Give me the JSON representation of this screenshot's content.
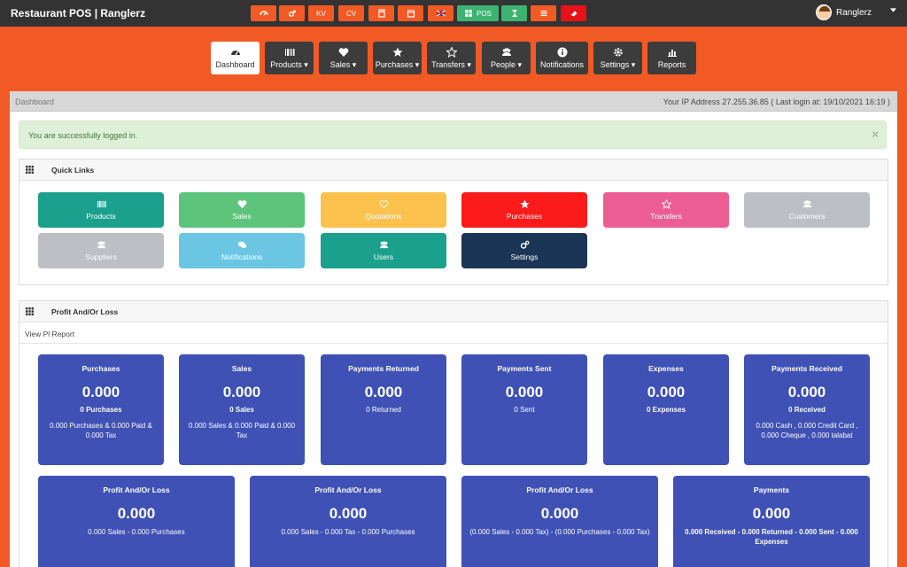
{
  "app": {
    "title": "Restaurant POS | Ranglerz"
  },
  "topbar": {
    "quick_buttons": [
      {
        "label": "",
        "icon": "dashboard-icon",
        "color": "#f15a24"
      },
      {
        "label": "",
        "icon": "cogs-icon",
        "color": "#f15a24"
      },
      {
        "label": "KV",
        "icon": "",
        "color": "#f15a24"
      },
      {
        "label": "CV",
        "icon": "",
        "color": "#f15a24"
      },
      {
        "label": "",
        "icon": "calculator-icon",
        "color": "#f15a24"
      },
      {
        "label": "",
        "icon": "calendar-icon",
        "color": "#f15a24"
      },
      {
        "label": "",
        "icon": "uk-flag-icon",
        "color": "#f15a24"
      },
      {
        "label": "POS",
        "icon": "grid-icon",
        "color": "#3cb371"
      },
      {
        "label": "",
        "icon": "hourglass-icon",
        "color": "#3cb371"
      },
      {
        "label": "",
        "icon": "list-icon",
        "color": "#f15a24"
      },
      {
        "label": "",
        "icon": "eraser-icon",
        "color": "#e8111a"
      }
    ],
    "user_name": "Ranglerz"
  },
  "nav": [
    {
      "label": "Dashboard",
      "icon": "dashboard-icon",
      "dropdown": false,
      "active": true
    },
    {
      "label": "Products",
      "icon": "barcode-icon",
      "dropdown": true
    },
    {
      "label": "Sales",
      "icon": "heart-icon",
      "dropdown": true
    },
    {
      "label": "Purchases",
      "icon": "star-icon",
      "dropdown": true
    },
    {
      "label": "Transfers",
      "icon": "star-outline-icon",
      "dropdown": true
    },
    {
      "label": "People",
      "icon": "users-icon",
      "dropdown": true
    },
    {
      "label": "Notifications",
      "icon": "info-icon",
      "dropdown": false
    },
    {
      "label": "Settings",
      "icon": "cog-icon",
      "dropdown": true
    },
    {
      "label": "Reports",
      "icon": "bar-chart-icon",
      "dropdown": false
    }
  ],
  "breadcrumb": {
    "label": "Dashboard",
    "ip_info": "Your IP Address 27.255.36.85 ( Last login at: 19/10/2021 16:19 )"
  },
  "alert": {
    "message": "You are successfully logged in.",
    "close": "×"
  },
  "quick_links": {
    "title": "Quick Links",
    "items": [
      {
        "label": "Products",
        "color": "#1aa08c",
        "icon": "barcode-icon"
      },
      {
        "label": "Sales",
        "color": "#5dc47b",
        "icon": "heart-icon"
      },
      {
        "label": "Quotations",
        "color": "#fbc24e",
        "icon": "heart-outline-icon"
      },
      {
        "label": "Purchases",
        "color": "#fb1b1b",
        "icon": "star-icon"
      },
      {
        "label": "Transfers",
        "color": "#ec5e93",
        "icon": "star-outline-icon"
      },
      {
        "label": "Customers",
        "color": "#bcc0c5",
        "icon": "users-icon"
      },
      {
        "label": "Suppliers",
        "color": "#bcc0c5",
        "icon": "users-icon"
      },
      {
        "label": "Notifications",
        "color": "#6bc6e3",
        "icon": "comments-icon"
      },
      {
        "label": "Users",
        "color": "#1aa08c",
        "icon": "users-icon"
      },
      {
        "label": "Settings",
        "color": "#1b3556",
        "icon": "cogs-icon"
      }
    ]
  },
  "profit": {
    "title": "Profit And/Or Loss",
    "link": "View Pl Report",
    "cards": [
      {
        "title": "Purchases",
        "value": "0.000",
        "sub": "0 Purchases",
        "detail": "0.000 Purchases & 0.000 Paid & 0.000 Tax"
      },
      {
        "title": "Sales",
        "value": "0.000",
        "sub": "0 Sales",
        "detail": "0.000 Sales & 0.000 Paid & 0.000 Tax"
      },
      {
        "title": "Payments Returned",
        "value": "0.000",
        "sub": "0 Returned",
        "detail": ""
      },
      {
        "title": "Payments Sent",
        "value": "0.000",
        "sub": "0 Sent",
        "detail": ""
      },
      {
        "title": "Expenses",
        "value": "0.000",
        "sub": "0 Expenses",
        "detail": ""
      },
      {
        "title": "Payments Received",
        "value": "0.000",
        "sub": "0 Received",
        "detail": "0.000 Cash , 0.000 Credit Card , 0.000 Cheque , 0.000 talabat"
      }
    ],
    "cards2": [
      {
        "title": "Profit And/Or Loss",
        "value": "0.000",
        "detail": "0.000 Sales - 0.000 Purchases"
      },
      {
        "title": "Profit And/Or Loss",
        "value": "0.000",
        "detail": "0.000 Sales - 0.000 Tax - 0.000 Purchases"
      },
      {
        "title": "Profit And/Or Loss",
        "value": "0.000",
        "detail": "(0.000 Sales - 0.000 Tax) - (0.000 Purchases - 0.000 Tax)"
      },
      {
        "title": "Payments",
        "value": "0.000",
        "detail": "0.000 Received - 0.000 Returned - 0.000 Sent - 0.000 Expenses"
      }
    ]
  }
}
